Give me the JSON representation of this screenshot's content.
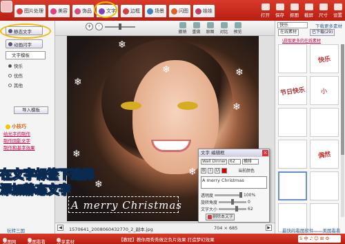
{
  "topbar": {
    "tabs": [
      {
        "label": "图片处理",
        "color": "#e04040"
      },
      {
        "label": "美容",
        "color": "#e04080"
      },
      {
        "label": "饰品",
        "color": "#d05080"
      },
      {
        "label": "文字",
        "color": "#8040c0"
      },
      {
        "label": "边框",
        "color": "#d04040"
      },
      {
        "label": "场景",
        "color": "#4080c0"
      },
      {
        "label": "闪图",
        "color": "#e06020"
      },
      {
        "label": "娃娃",
        "color": "#c04060"
      }
    ],
    "tools": [
      "打开",
      "保存",
      "抠图",
      "截屏",
      "尺寸",
      "设置"
    ]
  },
  "left": {
    "static_text": "静态文字",
    "animated_text": "动画闪字",
    "template_select": "文字模板",
    "radios": [
      "快乐",
      "优伤",
      "其他"
    ],
    "import_button": "导入模板",
    "tips_title": "小技巧",
    "tips": [
      "给光字的制作",
      "制作回影文字",
      "制作和基字效果"
    ],
    "bottom_link": "玩转三国"
  },
  "editor": {
    "zoom_in": "+",
    "zoom_out": "-",
    "tools": [
      "撤销",
      "重做",
      "原图",
      "对比",
      "预览"
    ]
  },
  "canvas": {
    "merry_text": "A merry Christmas",
    "overlay_line1": "在文字标签下选择",
    "overlay_line2": "添加静态文字"
  },
  "dialog": {
    "title": "文字 编辑框",
    "font": "Wall Dinner",
    "size": "62",
    "orientation": "横排",
    "color_label": "当前颜色",
    "text_value": "A merry Christmas",
    "opacity_label": "透明度",
    "opacity_value": "100%",
    "rotate_label": "旋转角度",
    "rotate_value": "0",
    "fontsize_label": "文字大小",
    "fontsize_value": "62",
    "delete_button": "删除本文字"
  },
  "status": {
    "filename": "1570641_2008060432770_2_副本.jpg",
    "dimensions": "704 × 685"
  },
  "right": {
    "category": "快乐",
    "download_more": "下载更多素材",
    "tab_online": "在线素材",
    "tab_downloaded": "已下载(29)",
    "get_more": "\\获取更多的在线素材",
    "thumbs": [
      "",
      "快乐",
      "节日快乐",
      "小",
      "",
      "",
      "",
      "偶然",
      "",
      "",
      "",
      ""
    ],
    "bottom": "最快的看图软件——美图看看"
  },
  "bottombar": {
    "items": [
      "美图网",
      "美图看看",
      "分享素材"
    ],
    "tutorial": "【教程】教你用秀秀做正负片效果 打造梦幻效果",
    "sogou": "S 中 ♪ ☺ ⊞ ⚙"
  }
}
